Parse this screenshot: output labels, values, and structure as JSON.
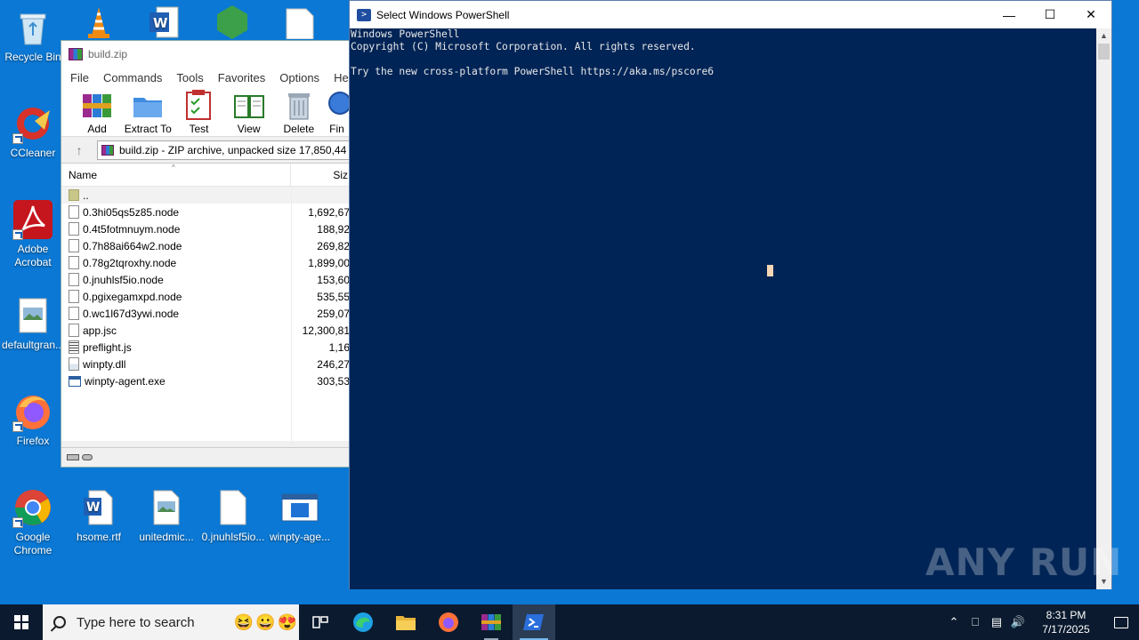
{
  "desktop": {
    "icons": [
      {
        "name": "recycle-bin",
        "label": "Recycle Bin"
      },
      {
        "name": "ccleaner",
        "label": "CCleaner"
      },
      {
        "name": "adobe-acrobat",
        "label": "Adobe Acrobat"
      },
      {
        "name": "defaultgran",
        "label": "defaultgran..."
      },
      {
        "name": "firefox",
        "label": "Firefox"
      },
      {
        "name": "google-chrome",
        "label": "Google Chrome"
      },
      {
        "name": "hsome-rtf",
        "label": "hsome.rtf"
      },
      {
        "name": "unitedmic",
        "label": "unitedmic..."
      },
      {
        "name": "jnuhlsf5io",
        "label": "0.jnuhlsf5io..."
      },
      {
        "name": "winpty-age",
        "label": "winpty-age..."
      }
    ]
  },
  "winrar": {
    "title": "build.zip",
    "menu": [
      "File",
      "Commands",
      "Tools",
      "Favorites",
      "Options",
      "Help"
    ],
    "toolbar": [
      "Add",
      "Extract To",
      "Test",
      "View",
      "Delete",
      "Fin"
    ],
    "path": "build.zip - ZIP archive, unpacked size 17,850,44",
    "columns": {
      "name": "Name",
      "size": "Siz"
    },
    "files": [
      {
        "name": "..",
        "size": "",
        "icon": "folder"
      },
      {
        "name": "0.3hi05qs5z85.node",
        "size": "1,692,67",
        "icon": "file"
      },
      {
        "name": "0.4t5fotmnuym.node",
        "size": "188,92",
        "icon": "file"
      },
      {
        "name": "0.7h88ai664w2.node",
        "size": "269,82",
        "icon": "file"
      },
      {
        "name": "0.78g2tqroxhy.node",
        "size": "1,899,00",
        "icon": "file"
      },
      {
        "name": "0.jnuhlsf5io.node",
        "size": "153,60",
        "icon": "file"
      },
      {
        "name": "0.pgixegamxpd.node",
        "size": "535,55",
        "icon": "file"
      },
      {
        "name": "0.wc1l67d3ywi.node",
        "size": "259,07",
        "icon": "file"
      },
      {
        "name": "app.jsc",
        "size": "12,300,81",
        "icon": "file"
      },
      {
        "name": "preflight.js",
        "size": "1,16",
        "icon": "js"
      },
      {
        "name": "winpty.dll",
        "size": "246,27",
        "icon": "dll"
      },
      {
        "name": "winpty-agent.exe",
        "size": "303,53",
        "icon": "exe"
      }
    ]
  },
  "powershell": {
    "title": "Select Windows PowerShell",
    "lines": [
      "Windows PowerShell",
      "Copyright (C) Microsoft Corporation. All rights reserved.",
      "",
      "Try the new cross-platform PowerShell https://aka.ms/pscore6"
    ]
  },
  "watermark": "ANY RUN",
  "taskbar": {
    "search_placeholder": "Type here to search",
    "time": "8:31 PM",
    "date": "7/17/2025"
  }
}
